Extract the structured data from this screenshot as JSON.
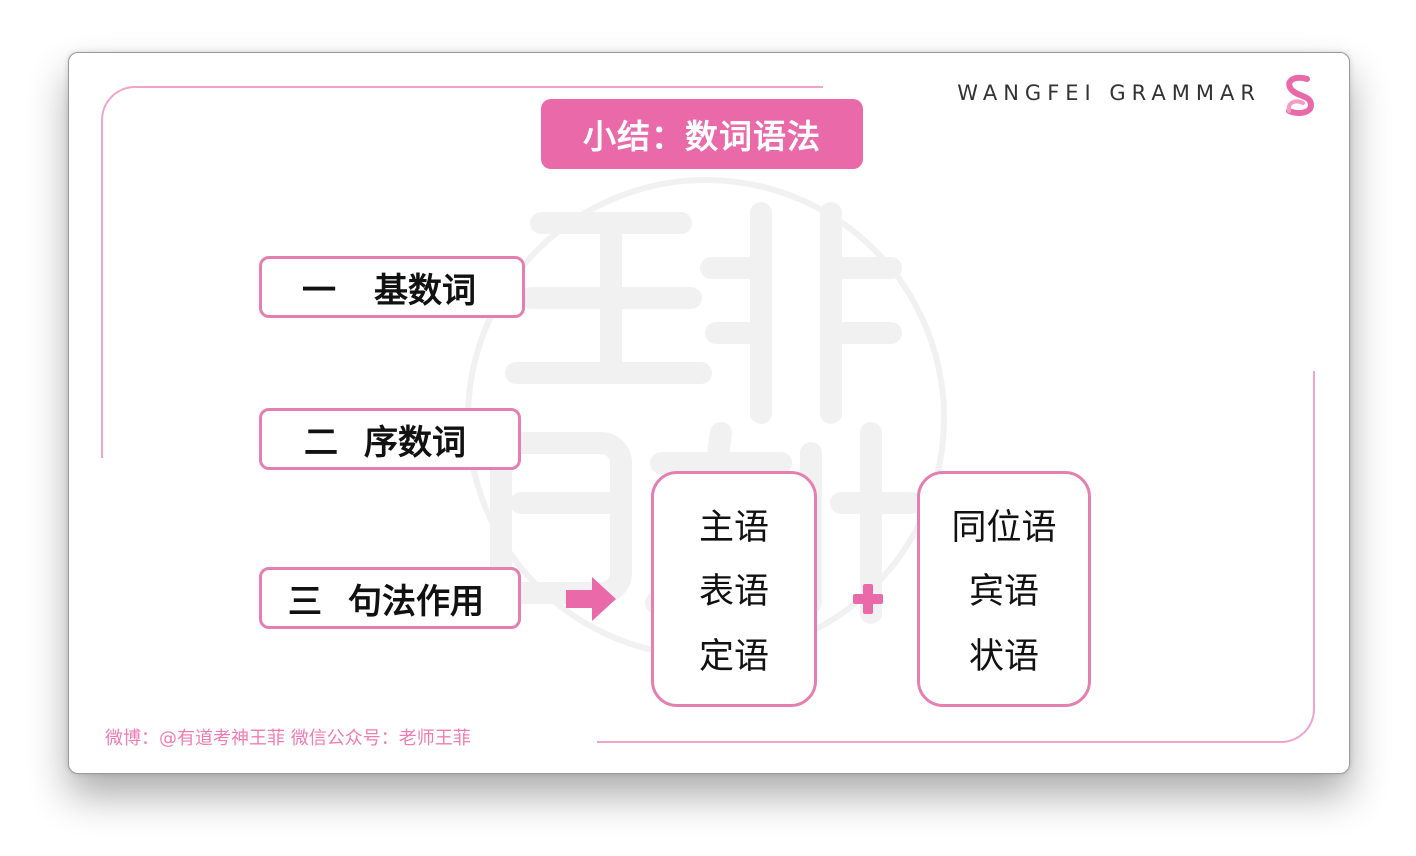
{
  "brand": {
    "text": "WANGFEI GRAMMAR",
    "logo_icon": "s-ribbon-logo-icon"
  },
  "title": "小结：数词语法",
  "items": [
    {
      "num": "一",
      "label": "基数词"
    },
    {
      "num": "二",
      "label": "序数词"
    },
    {
      "num": "三",
      "label": "句法作用"
    }
  ],
  "group_a": [
    "主语",
    "表语",
    "定语"
  ],
  "group_b": [
    "同位语",
    "宾语",
    "状语"
  ],
  "footer": "微博：@有道考神王菲 微信公众号：老师王菲",
  "colors": {
    "accent": "#ea6aa9",
    "border": "#e57fb2",
    "frame": "#f2a3cc",
    "watermark": "#f0f0f0"
  }
}
